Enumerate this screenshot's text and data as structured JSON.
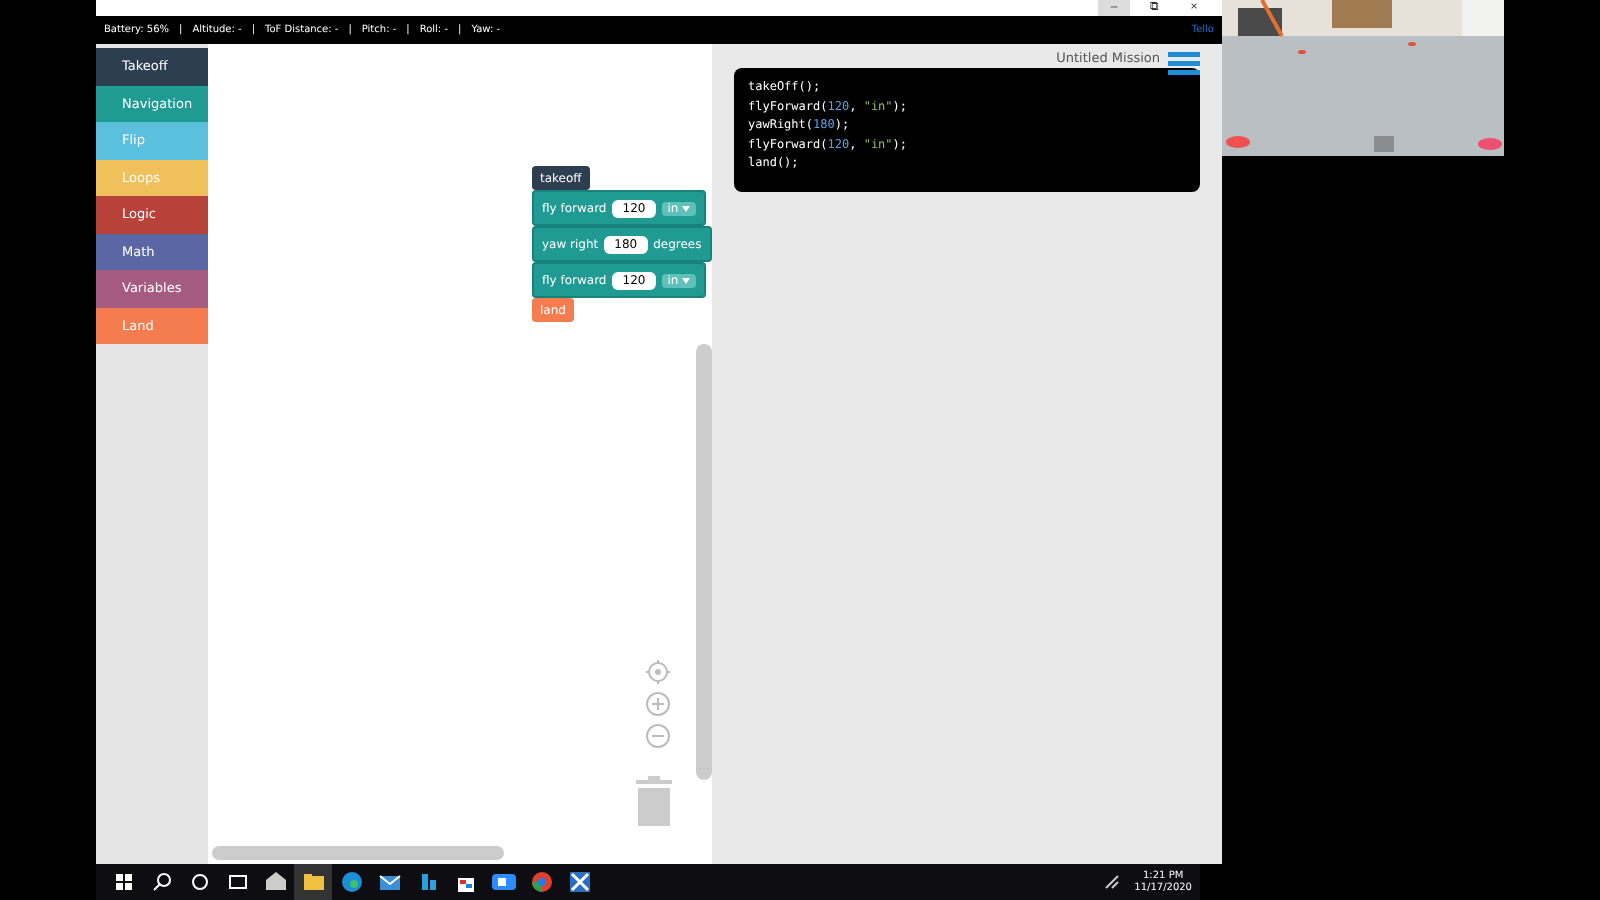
{
  "window": {
    "buttons": [
      "–",
      "⧉",
      "×"
    ]
  },
  "status_bar": {
    "items": [
      "Battery: 56%",
      "Altitude: -",
      "ToF Distance: -",
      "Pitch: -",
      "Roll: -",
      "Yaw: -"
    ],
    "separator": "|",
    "brand": "Tello"
  },
  "toolbox": {
    "categories": [
      {
        "label": "Takeoff",
        "color": "#2c3e50"
      },
      {
        "label": "Navigation",
        "color": "#1f9b94"
      },
      {
        "label": "Flip",
        "color": "#5bc0de"
      },
      {
        "label": "Loops",
        "color": "#f0c05a"
      },
      {
        "label": "Logic",
        "color": "#b8413a"
      },
      {
        "label": "Math",
        "color": "#5b67a5"
      },
      {
        "label": "Variables",
        "color": "#a55b80"
      },
      {
        "label": "Land",
        "color": "#f47c4f"
      }
    ]
  },
  "workspace": {
    "blocks": [
      {
        "kind": "takeoff",
        "label": "takeoff"
      },
      {
        "kind": "move",
        "label": "fly forward",
        "value": "120",
        "unit": "in"
      },
      {
        "kind": "yaw",
        "label": "yaw right",
        "value": "180",
        "suffix": "degrees"
      },
      {
        "kind": "move",
        "label": "fly forward",
        "value": "120",
        "unit": "in"
      },
      {
        "kind": "land",
        "label": "land"
      }
    ]
  },
  "code_panel": {
    "title": "Untitled Mission",
    "lines": [
      [
        {
          "kind": "plain",
          "text": "takeOff();"
        }
      ],
      [
        {
          "kind": "plain",
          "text": "flyForward("
        },
        {
          "kind": "number",
          "text": "120"
        },
        {
          "kind": "plain",
          "text": ", "
        },
        {
          "kind": "string",
          "text": "\"in\""
        },
        {
          "kind": "plain",
          "text": ");"
        }
      ],
      [
        {
          "kind": "plain",
          "text": "yawRight("
        },
        {
          "kind": "number",
          "text": "180"
        },
        {
          "kind": "plain",
          "text": ");"
        }
      ],
      [
        {
          "kind": "plain",
          "text": "flyForward("
        },
        {
          "kind": "number",
          "text": "120"
        },
        {
          "kind": "plain",
          "text": ", "
        },
        {
          "kind": "string",
          "text": "\"in\""
        },
        {
          "kind": "plain",
          "text": ");"
        }
      ],
      [
        {
          "kind": "plain",
          "text": "land();"
        }
      ]
    ]
  },
  "taskbar": {
    "time": "1:21 PM",
    "date": "11/17/2020"
  }
}
